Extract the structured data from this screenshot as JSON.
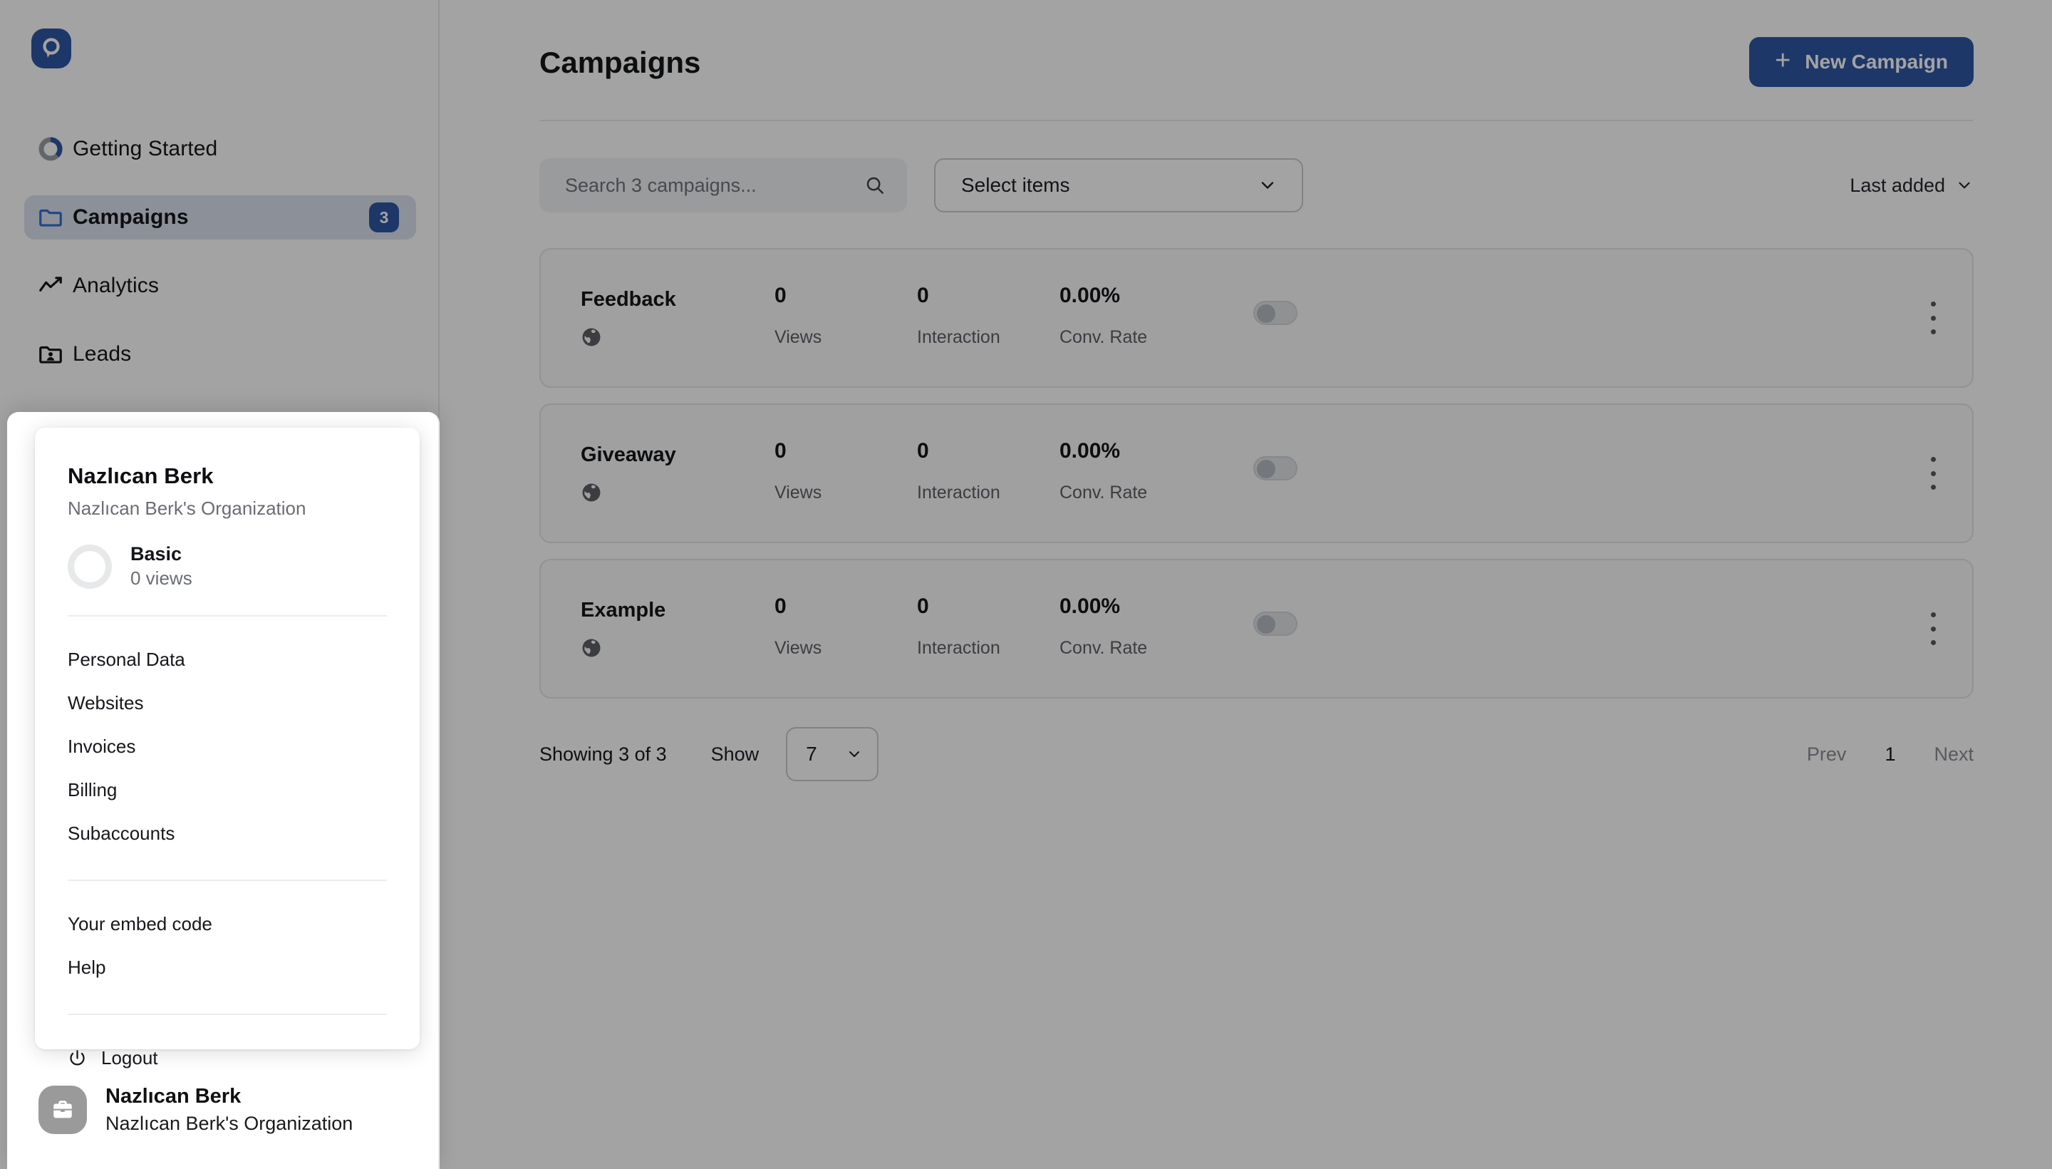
{
  "brand": {
    "logo_icon": "app-logo-p-icon",
    "accent": "#2f57a4"
  },
  "sidebar": {
    "items": [
      {
        "label": "Getting Started",
        "icon": "progress-ring-icon",
        "badge": null,
        "active": false
      },
      {
        "label": "Campaigns",
        "icon": "folder-icon",
        "badge": "3",
        "active": true
      },
      {
        "label": "Analytics",
        "icon": "line-chart-icon",
        "badge": null,
        "active": false
      },
      {
        "label": "Leads",
        "icon": "folder-user-icon",
        "badge": null,
        "active": false
      }
    ],
    "user": {
      "name": "Nazlıcan Berk",
      "org": "Nazlıcan Berk's Organization",
      "avatar_icon": "briefcase-icon"
    }
  },
  "header": {
    "title": "Campaigns",
    "new_campaign_label": "New Campaign",
    "plus_icon": "plus-icon"
  },
  "filters": {
    "search_placeholder": "Search 3 campaigns...",
    "search_value": "",
    "search_icon": "search-icon",
    "select_items_label": "Select items",
    "chevron_icon": "chevron-down-icon",
    "sort_label": "Last added"
  },
  "table": {
    "metric_labels": {
      "views": "Views",
      "interaction": "Interaction",
      "conv_rate": "Conv. Rate"
    },
    "rows": [
      {
        "name": "Feedback",
        "globe_icon": "globe-icon",
        "views": "0",
        "interaction": "0",
        "conv_rate": "0.00%",
        "enabled": false,
        "menu_icon": "kebab-menu-icon"
      },
      {
        "name": "Giveaway",
        "globe_icon": "globe-icon",
        "views": "0",
        "interaction": "0",
        "conv_rate": "0.00%",
        "enabled": false,
        "menu_icon": "kebab-menu-icon"
      },
      {
        "name": "Example",
        "globe_icon": "globe-icon",
        "views": "0",
        "interaction": "0",
        "conv_rate": "0.00%",
        "enabled": false,
        "menu_icon": "kebab-menu-icon"
      }
    ]
  },
  "pagination": {
    "showing": "Showing 3 of 3",
    "show_label": "Show",
    "page_size": "7",
    "prev": "Prev",
    "current_page": "1",
    "next": "Next"
  },
  "account_menu": {
    "name": "Nazlıcan Berk",
    "org": "Nazlıcan Berk's Organization",
    "plan_name": "Basic",
    "plan_views": "0 views",
    "group1": [
      "Personal Data",
      "Websites",
      "Invoices",
      "Billing",
      "Subaccounts"
    ],
    "group2": [
      "Your embed code",
      "Help"
    ],
    "logout_label": "Logout",
    "logout_icon": "power-icon"
  }
}
